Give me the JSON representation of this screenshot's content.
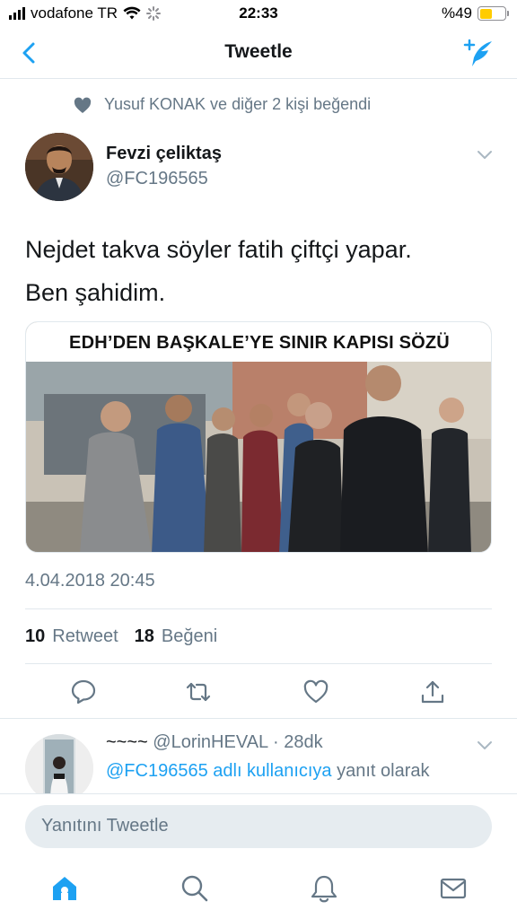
{
  "status_bar": {
    "carrier": "vodafone TR",
    "time": "22:33",
    "battery_text": "%49",
    "battery_level": 0.49
  },
  "nav": {
    "title": "Tweetle",
    "back_icon": "chevron-left-icon",
    "compose_icon": "compose-tweet-icon"
  },
  "social_context": {
    "icon": "heart-icon",
    "text": "Yusuf KONAK ve diğer 2 kişi beğendi"
  },
  "tweet": {
    "author_name": "Fevzi çeliktaş",
    "author_handle": "@FC196565",
    "text_line1": "Nejdet takva söyler fatih çiftçi yapar.",
    "text_line2": "Ben şahidim.",
    "media_headline": "EDH’DEN BAŞKALE’YE SINIR KAPISI SÖZÜ",
    "timestamp": "4.04.2018 20:45",
    "retweet_count": "10",
    "retweet_label": "Retweet",
    "like_count": "18",
    "like_label": "Beğeni"
  },
  "reply": {
    "display_name": "~~~~",
    "handle": "@LorinHEVAL",
    "age": "· 28dk",
    "context_link": "@FC196565 adlı kullanıcıya",
    "context_suffix": "yanıt olarak"
  },
  "compose": {
    "placeholder": "Yanıtını Tweetle"
  },
  "colors": {
    "accent": "#1da1f2",
    "muted": "#657786",
    "divider": "#e1e8ed",
    "battery": "#ffcc00"
  }
}
